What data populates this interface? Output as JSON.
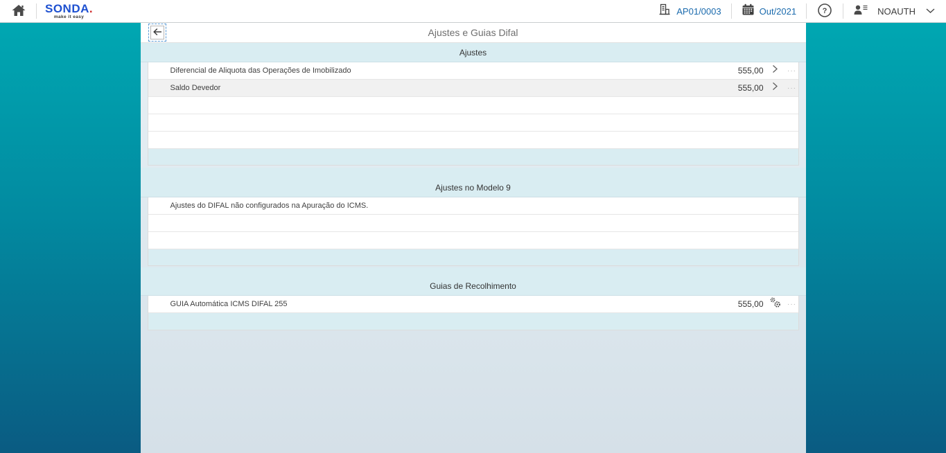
{
  "topbar": {
    "logo_text": "SONDA",
    "logo_dot": ".",
    "logo_tagline": "make it easy",
    "establishment": "AP01/0003",
    "period": "Out/2021",
    "user_label": "NOAUTH"
  },
  "panel": {
    "title": "Ajustes e Guias Difal"
  },
  "sections": [
    {
      "title": "Ajustes",
      "rows": [
        {
          "label": "Diferencial de Aliquota das Operações de Imobilizado",
          "value": "555,00"
        },
        {
          "label": "Saldo Devedor",
          "value": "555,00"
        }
      ]
    },
    {
      "title": "Ajustes no Modelo 9",
      "rows": [
        {
          "label": "Ajustes do DIFAL não configurados na Apuração do ICMS."
        }
      ]
    },
    {
      "title": "Guias de Recolhimento",
      "rows": [
        {
          "label": "GUIA Automática ICMS DIFAL 255",
          "value": "555,00"
        }
      ]
    }
  ],
  "misc": {
    "row_more_dots": "···"
  },
  "colors": {
    "background_teal_top": "#00a7b2",
    "background_blue_bottom": "#0a5b82",
    "section_band": "#d9edf2",
    "link_blue": "#1a6aad",
    "logo_blue": "#1d50d0",
    "logo_dot_red": "#cf2b2b",
    "alt_row_gray": "#f1f1f1"
  }
}
